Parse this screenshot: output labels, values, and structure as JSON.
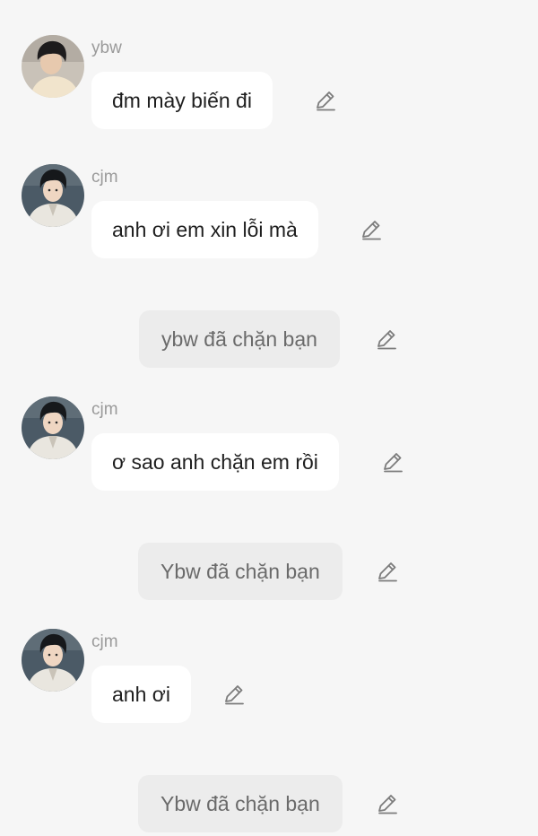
{
  "colors": {
    "background": "#f6f6f6",
    "bubble": "#ffffff",
    "system_bubble": "#ececec",
    "sender_text": "#9a9a9a",
    "message_text": "#1f1f1f",
    "system_text": "#6a6a6a",
    "edit_icon": "#7c7c7c"
  },
  "messages": [
    {
      "type": "message",
      "sender": "ybw",
      "avatar": "avatar-ybw-photo",
      "text": "đm mày biến đi",
      "icon": "pencil-edit-icon"
    },
    {
      "type": "message",
      "sender": "cjm",
      "avatar": "avatar-cjm-photo",
      "text": "anh ơi em xin lỗi mà",
      "icon": "pencil-edit-icon"
    },
    {
      "type": "system",
      "text": "ybw đã chặn bạn",
      "icon": "pencil-edit-icon"
    },
    {
      "type": "message",
      "sender": "cjm",
      "avatar": "avatar-cjm-photo",
      "text": "ơ sao anh chặn em rồi",
      "icon": "pencil-edit-icon"
    },
    {
      "type": "system",
      "text": "Ybw đã chặn bạn",
      "icon": "pencil-edit-icon"
    },
    {
      "type": "message",
      "sender": "cjm",
      "avatar": "avatar-cjm-photo",
      "text": "anh ơi",
      "icon": "pencil-edit-icon"
    },
    {
      "type": "system",
      "text": "Ybw đã chặn bạn",
      "icon": "pencil-edit-icon"
    }
  ]
}
